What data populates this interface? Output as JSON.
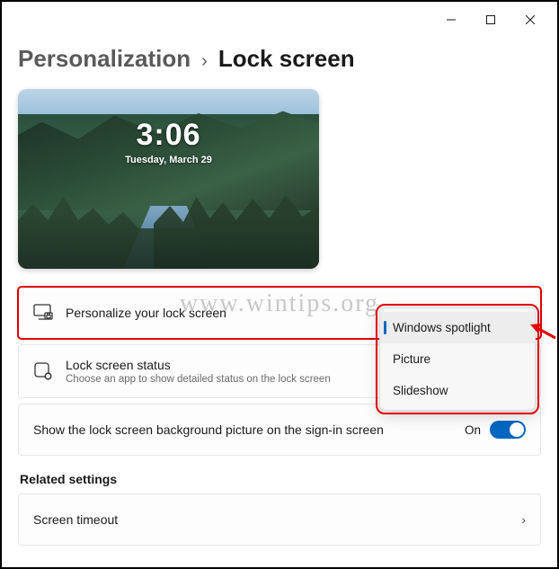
{
  "breadcrumb": {
    "parent": "Personalization",
    "current": "Lock screen"
  },
  "preview": {
    "time": "3:06",
    "date": "Tuesday, March 29"
  },
  "watermark": "www.wintips.org",
  "rows": {
    "personalize": {
      "title": "Personalize your lock screen"
    },
    "status": {
      "title": "Lock screen status",
      "sub": "Choose an app to show detailed status on the lock screen"
    },
    "signin": {
      "title": "Show the lock screen background picture on the sign-in screen",
      "state": "On"
    }
  },
  "dropdown": {
    "opt1": "Windows spotlight",
    "opt2": "Picture",
    "opt3": "Slideshow"
  },
  "related": {
    "header": "Related settings",
    "timeout": "Screen timeout"
  },
  "colors": {
    "accent": "#0067c0",
    "highlight": "#e30000"
  }
}
